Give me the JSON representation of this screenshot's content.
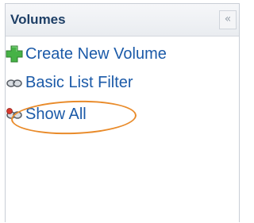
{
  "panel": {
    "title": "Volumes",
    "collapse_icon": "double-chevron-left-icon",
    "collapse_glyph": "«"
  },
  "menu": {
    "items": [
      {
        "label": "Create New Volume",
        "icon": "add-icon",
        "icon_color": "#3aa33a"
      },
      {
        "label": "Basic List Filter",
        "icon": "filter-icon",
        "icon_color": "#6b7280"
      },
      {
        "label": "Show All",
        "icon": "filter-remove-icon",
        "icon_color": "#6b7280"
      }
    ]
  },
  "colors": {
    "title": "#1e3f66",
    "link": "#1b5aa8",
    "highlight": "#e98b2a"
  }
}
